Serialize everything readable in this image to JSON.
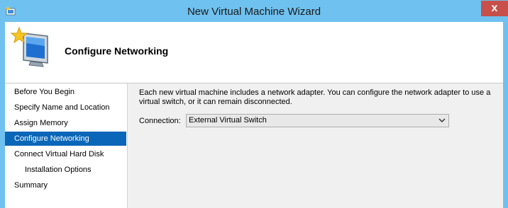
{
  "window": {
    "title": "New Virtual Machine Wizard",
    "close_glyph": "x",
    "icon": "wizard-app-icon"
  },
  "header": {
    "title": "Configure Networking",
    "icon": "monitor-with-star-icon"
  },
  "sidebar": {
    "items": [
      {
        "label": "Before You Begin",
        "active": false
      },
      {
        "label": "Specify Name and Location",
        "active": false
      },
      {
        "label": "Assign Memory",
        "active": false
      },
      {
        "label": "Configure Networking",
        "active": true
      },
      {
        "label": "Connect Virtual Hard Disk",
        "active": false
      },
      {
        "label": "Installation Options",
        "active": false
      },
      {
        "label": "Summary",
        "active": false
      }
    ]
  },
  "main": {
    "description": "Each new virtual machine includes a network adapter. You can configure the network adapter to use a virtual switch, or it can remain disconnected.",
    "connection_label": "Connection:",
    "connection_value": "External Virtual Switch"
  },
  "colors": {
    "titlebar": "#6fc1ef",
    "close": "#c7504a",
    "active_item": "#0a66b8"
  }
}
